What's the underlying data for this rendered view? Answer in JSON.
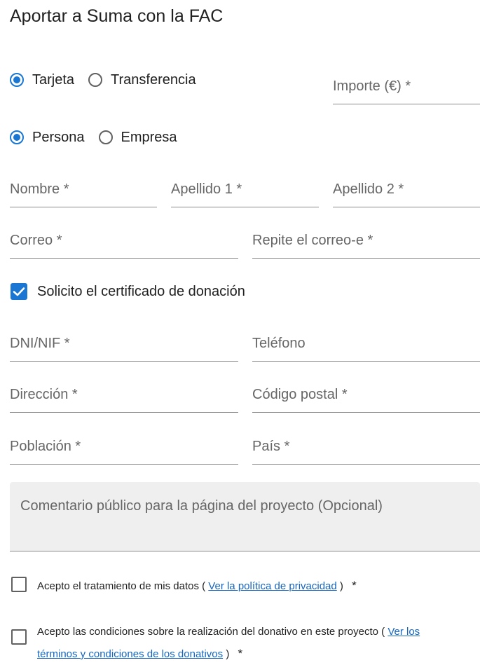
{
  "title": "Aportar a Suma con la FAC",
  "payment_method": {
    "options": [
      "Tarjeta",
      "Transferencia"
    ],
    "selected": "Tarjeta"
  },
  "donor_type": {
    "options": [
      "Persona",
      "Empresa"
    ],
    "selected": "Persona"
  },
  "fields": {
    "importe": "Importe (€)  *",
    "nombre": "Nombre  *",
    "apellido1": "Apellido 1  *",
    "apellido2": "Apellido 2  *",
    "correo": "Correo  *",
    "repite_correo": "Repite el correo-e  *",
    "dni": "DNI/NIF  *",
    "telefono": "Teléfono",
    "direccion": "Dirección  *",
    "codigo_postal": "Código postal  *",
    "poblacion": "Población  *",
    "pais": "País  *"
  },
  "certificate": {
    "label": "Solicito el certificado de donación",
    "checked": true
  },
  "comment_placeholder": "Comentario público para la página del proyecto (Opcional)",
  "privacy": {
    "text_before": "Acepto el tratamiento de mis datos (",
    "link": "Ver la política de privacidad",
    "text_after": ")",
    "required": "*",
    "checked": false
  },
  "terms": {
    "text_before": "Acepto las condiciones sobre la realización del donativo en este proyecto (",
    "link": "Ver los términos y condiciones de los donativos",
    "text_after": ")",
    "required": "*",
    "checked": false
  },
  "colors": {
    "accent": "#1976d2",
    "link": "#1565c0"
  }
}
